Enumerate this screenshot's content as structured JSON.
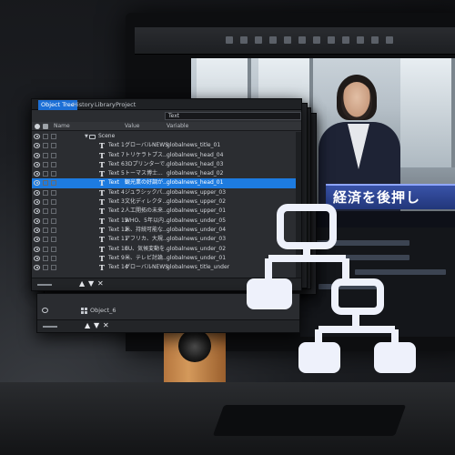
{
  "tabs": [
    "Object Tree",
    "History",
    "Library",
    "Project"
  ],
  "search": {
    "value": "Text"
  },
  "columns": {
    "name": "Name",
    "value": "Value",
    "variable": "Variable"
  },
  "scene_label": "Scene",
  "rows": [
    {
      "name": "Text 1",
      "value": "グローバルNEWS",
      "variable": "globalnews_title_01",
      "selected": false
    },
    {
      "name": "Text 7",
      "value": "トリケラトプス...",
      "variable": "globalnews_head_04",
      "selected": false
    },
    {
      "name": "Text 6",
      "value": "3Dプリンターで...",
      "variable": "globalnews_head_03",
      "selected": false
    },
    {
      "name": "Text 5",
      "value": "トーマス博士...",
      "variable": "globalnews_head_02",
      "selected": false
    },
    {
      "name": "Text",
      "value": "観光業の好調が...",
      "variable": "globalnews_head_01",
      "selected": true
    },
    {
      "name": "Text 4",
      "value": "ジュラシックパ...",
      "variable": "globalnews_upper_03",
      "selected": false
    },
    {
      "name": "Text 3",
      "value": "文化ディレクタ...",
      "variable": "globalnews_upper_02",
      "selected": false
    },
    {
      "name": "Text 2",
      "value": "人工開拓の未来...",
      "variable": "globalnews_upper_01",
      "selected": false
    },
    {
      "name": "Text 13",
      "value": "WHO、5年以内...",
      "variable": "globalnews_under_05",
      "selected": false
    },
    {
      "name": "Text 12",
      "value": "米、持続可能な...",
      "variable": "globalnews_under_04",
      "selected": false
    },
    {
      "name": "Text 11",
      "value": "アフリカ、大規...",
      "variable": "globalnews_under_03",
      "selected": false
    },
    {
      "name": "Text 10",
      "value": "EU、気候変動を...",
      "variable": "globalnews_under_02",
      "selected": false
    },
    {
      "name": "Text 9",
      "value": "米、テレビ討論...",
      "variable": "globalnews_under_01",
      "selected": false
    },
    {
      "name": "Text 14",
      "value": "グローバルNEWS",
      "variable": "globalnews_title_under",
      "selected": false
    }
  ],
  "footer_controls": [
    "▲",
    "▼",
    "✕"
  ],
  "panel2": {
    "object_label": "Object_6"
  },
  "ticker_text": "経済を後押し",
  "colors": {
    "accent": "#1d7be0",
    "icon": "#eef1fb",
    "ticker": "#2a3f8f"
  },
  "icons": [
    "eye-icon",
    "lock-icon",
    "text-icon",
    "folder-icon",
    "hierarchy-icon"
  ]
}
